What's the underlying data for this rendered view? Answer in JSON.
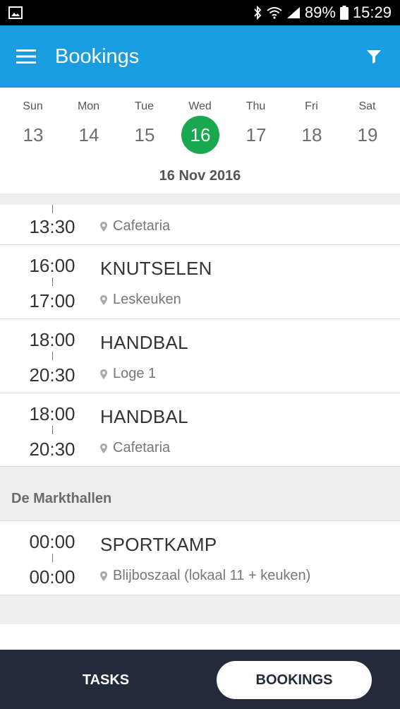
{
  "status_bar": {
    "battery_percent": "89%",
    "time": "15:29"
  },
  "app_bar": {
    "title": "Bookings",
    "menu_icon": "hamburger-menu-icon",
    "filter_icon": "filter-funnel-icon",
    "color": "#1a9de0"
  },
  "week": {
    "days": [
      {
        "name": "Sun",
        "num": "13"
      },
      {
        "name": "Mon",
        "num": "14"
      },
      {
        "name": "Tue",
        "num": "15"
      },
      {
        "name": "Wed",
        "num": "16"
      },
      {
        "name": "Thu",
        "num": "17"
      },
      {
        "name": "Fri",
        "num": "18"
      },
      {
        "name": "Sat",
        "num": "19"
      }
    ],
    "selected_day": "16",
    "selected_color": "#1aa84f",
    "date_label": "16 Nov 2016"
  },
  "bookings": [
    {
      "start": "",
      "end": "13:30",
      "title": "",
      "location": "Cafetaria"
    },
    {
      "start": "16:00",
      "end": "17:00",
      "title": "KNUTSELEN",
      "location": "Leskeuken"
    },
    {
      "start": "18:00",
      "end": "20:30",
      "title": "HANDBAL",
      "location": "Loge 1"
    },
    {
      "start": "18:00",
      "end": "20:30",
      "title": "HANDBAL",
      "location": "Cafetaria"
    }
  ],
  "sections": [
    {
      "name": "De Markthallen",
      "bookings": [
        {
          "start": "00:00",
          "end": "00:00",
          "title": "SPORTKAMP",
          "location": "Blijboszaal (lokaal 11 + keuken)"
        }
      ]
    }
  ],
  "bottom_nav": {
    "tasks_label": "TASKS",
    "bookings_label": "BOOKINGS",
    "color": "#222b3a"
  }
}
